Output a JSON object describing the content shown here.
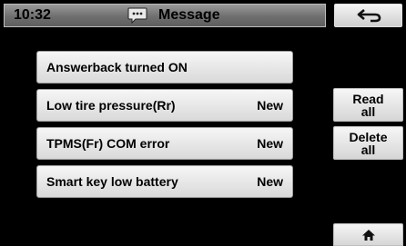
{
  "header": {
    "time": "10:32",
    "title": "Message",
    "icons": {
      "title": "message-icon",
      "back": "return-arrow-icon"
    }
  },
  "messages": [
    {
      "label": "Answerback turned ON",
      "badge": ""
    },
    {
      "label": "Low tire pressure(Rr)",
      "badge": "New"
    },
    {
      "label": "TPMS(Fr) COM error",
      "badge": "New"
    },
    {
      "label": "Smart key low battery",
      "badge": "New"
    }
  ],
  "actions": {
    "read_all": "Read\nall",
    "delete_all": "Delete\nall",
    "home_icon": "home-icon"
  }
}
